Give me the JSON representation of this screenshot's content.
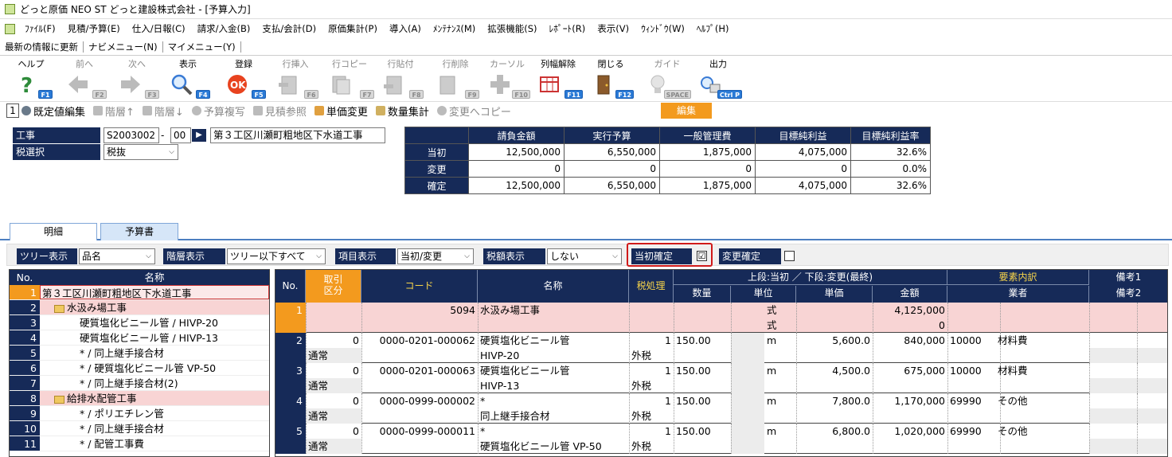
{
  "window": {
    "title": "どっと原価 NEO ST どっと建設株式会社 - [予算入力]"
  },
  "menu": [
    "ﾌｧｲﾙ(F)",
    "見積/予算(E)",
    "仕入/日報(C)",
    "請求/入金(B)",
    "支払/会計(D)",
    "原価集計(P)",
    "導入(A)",
    "ﾒﾝﾃﾅﾝｽ(M)",
    "拡張機能(S)",
    "ﾚﾎﾟｰﾄ(R)",
    "表示(V)",
    "ｳｨﾝﾄﾞｳ(W)",
    "ﾍﾙﾌﾟ(H)"
  ],
  "nav": {
    "refresh": "最新の情報に更新",
    "navi_menu": "ナビメニュー(N)",
    "my_menu": "マイメニュー(Y)"
  },
  "toolbar": [
    {
      "label": "ヘルプ",
      "key": "F1",
      "icon": "help-icon",
      "enabled": true
    },
    {
      "label": "前へ",
      "key": "F2",
      "icon": "arrow-left-icon",
      "enabled": false
    },
    {
      "label": "次へ",
      "key": "F3",
      "icon": "arrow-right-icon",
      "enabled": false
    },
    {
      "label": "表示",
      "key": "F4",
      "icon": "magnifier-icon",
      "enabled": true
    },
    {
      "label": "登録",
      "key": "F5",
      "icon": "ok-icon",
      "enabled": true
    },
    {
      "label": "行挿入",
      "key": "F6",
      "icon": "insert-row-icon",
      "enabled": false
    },
    {
      "label": "行コピー",
      "key": "F7",
      "icon": "copy-row-icon",
      "enabled": false
    },
    {
      "label": "行貼付",
      "key": "F8",
      "icon": "paste-row-icon",
      "enabled": false
    },
    {
      "label": "行削除",
      "key": "F9",
      "icon": "delete-row-icon",
      "enabled": false
    },
    {
      "label": "カーソル",
      "key": "F10",
      "icon": "cursor-icon",
      "enabled": false
    },
    {
      "label": "列幅解除",
      "key": "F11",
      "icon": "column-width-icon",
      "enabled": true
    },
    {
      "label": "閉じる",
      "key": "F12",
      "icon": "door-icon",
      "enabled": true
    },
    {
      "label": "ガイド",
      "key": "SPACE",
      "icon": "lightbulb-icon",
      "enabled": false
    },
    {
      "label": "出力",
      "key": "Ctrl P",
      "icon": "output-icon",
      "enabled": true
    }
  ],
  "itembar": {
    "num": "1",
    "items": [
      {
        "label": "既定値編集",
        "enabled": true
      },
      {
        "label": "階層↑",
        "enabled": false
      },
      {
        "label": "階層↓",
        "enabled": false
      },
      {
        "label": "予算複写",
        "enabled": false
      },
      {
        "label": "見積参照",
        "enabled": false
      },
      {
        "label": "単価変更",
        "enabled": true
      },
      {
        "label": "数量集計",
        "enabled": true
      },
      {
        "label": "変更へコピー",
        "enabled": false
      }
    ],
    "edit": "編集"
  },
  "header": {
    "koji_label": "工事",
    "koji_code": "S2003002",
    "koji_dash": "-",
    "koji_sub": "00",
    "koji_name": "第３工区川瀬町粗地区下水道工事",
    "tax_label": "税選択",
    "tax_value": "税抜"
  },
  "summary": {
    "cols": [
      "請負金額",
      "実行予算",
      "一般管理費",
      "目標純利益",
      "目標純利益率"
    ],
    "rows": [
      {
        "label": "当初",
        "values": [
          "12,500,000",
          "6,550,000",
          "1,875,000",
          "4,075,000",
          "32.6%"
        ]
      },
      {
        "label": "変更",
        "values": [
          "0",
          "0",
          "0",
          "0",
          "0.0%"
        ]
      },
      {
        "label": "確定",
        "values": [
          "12,500,000",
          "6,550,000",
          "1,875,000",
          "4,075,000",
          "32.6%"
        ]
      }
    ]
  },
  "tabs": [
    "明細",
    "予算書"
  ],
  "filters": {
    "tree_label": "ツリー表示",
    "tree_value": "品名",
    "level_label": "階層表示",
    "level_value": "ツリー以下すべて",
    "item_label": "項目表示",
    "item_value": "当初/変更",
    "tax_label": "税額表示",
    "tax_value": "しない",
    "initial_label": "当初確定",
    "initial_check": "☑",
    "change_label": "変更確定"
  },
  "tree": {
    "headers": [
      "No.",
      "名称"
    ],
    "rows": [
      {
        "n": "1",
        "name": "第３工区川瀬町粗地区下水道工事",
        "cls": "sel",
        "indent": 0
      },
      {
        "n": "2",
        "name": "水汲み場工事",
        "cls": "pink",
        "indent": 1
      },
      {
        "n": "3",
        "name": "硬質塩化ビニール管 / HIVP-20",
        "cls": "",
        "indent": 2
      },
      {
        "n": "4",
        "name": "硬質塩化ビニール管 / HIVP-13",
        "cls": "",
        "indent": 2
      },
      {
        "n": "5",
        "name": "* / 同上継手接合材",
        "cls": "",
        "indent": 2
      },
      {
        "n": "6",
        "name": "* / 硬質塩化ビニール管 VP-50",
        "cls": "",
        "indent": 2
      },
      {
        "n": "7",
        "name": "* / 同上継手接合材(2)",
        "cls": "",
        "indent": 2
      },
      {
        "n": "8",
        "name": "給排水配管工事",
        "cls": "pink",
        "indent": 1
      },
      {
        "n": "9",
        "name": "* / ポリエチレン管",
        "cls": "",
        "indent": 2
      },
      {
        "n": "10",
        "name": "* / 同上継手接合材",
        "cls": "",
        "indent": 2
      },
      {
        "n": "11",
        "name": "* / 配管工事費",
        "cls": "",
        "indent": 2
      }
    ]
  },
  "grid": {
    "headers": {
      "no": "No.",
      "kubun": "取引\n区分",
      "code": "コード",
      "name": "名称",
      "tax": "税処理",
      "top": "上段:当初 ／ 下段:変更(最終)",
      "qty": "数量",
      "unit": "単位",
      "price": "単価",
      "amount": "金額",
      "breakdown": "要素内訳",
      "vendor": "業者",
      "note1": "備考1",
      "note2": "備考2"
    },
    "rows": [
      {
        "no": "1",
        "kubun1": "",
        "kubun2": "",
        "code": "5094",
        "name1": "水汲み場工事",
        "name2": "",
        "tax1": "",
        "tax2": "",
        "qty": "",
        "unit1": "式",
        "unit2": "式",
        "price": "",
        "amt1": "4,125,000",
        "amt2": "0",
        "el": "",
        "vendor": "",
        "pink": true
      },
      {
        "no": "2",
        "kubun1": "0",
        "kubun2": "通常",
        "code": "0000-0201-000062",
        "name1": "硬質塩化ビニール管",
        "name2": "HIVP-20",
        "tax1": "1",
        "tax2": "外税",
        "qty": "150.00",
        "unit1": "m",
        "unit2": "",
        "price": "5,600.0",
        "amt1": "840,000",
        "amt2": "",
        "el": "10000",
        "vendor": "材料費",
        "pink": false
      },
      {
        "no": "3",
        "kubun1": "0",
        "kubun2": "通常",
        "code": "0000-0201-000063",
        "name1": "硬質塩化ビニール管",
        "name2": "HIVP-13",
        "tax1": "1",
        "tax2": "外税",
        "qty": "150.00",
        "unit1": "m",
        "unit2": "",
        "price": "4,500.0",
        "amt1": "675,000",
        "amt2": "",
        "el": "10000",
        "vendor": "材料費",
        "pink": false
      },
      {
        "no": "4",
        "kubun1": "0",
        "kubun2": "通常",
        "code": "0000-0999-000002",
        "name1": "*",
        "name2": "同上継手接合材",
        "tax1": "1",
        "tax2": "外税",
        "qty": "150.00",
        "unit1": "m",
        "unit2": "",
        "price": "7,800.0",
        "amt1": "1,170,000",
        "amt2": "",
        "el": "69990",
        "vendor": "その他",
        "pink": false
      },
      {
        "no": "5",
        "kubun1": "0",
        "kubun2": "通常",
        "code": "0000-0999-000011",
        "name1": "*",
        "name2": "硬質塩化ビニール管 VP-50",
        "tax1": "1",
        "tax2": "外税",
        "qty": "150.00",
        "unit1": "m",
        "unit2": "",
        "price": "6,800.0",
        "amt1": "1,020,000",
        "amt2": "",
        "el": "69990",
        "vendor": "その他",
        "pink": false
      }
    ]
  }
}
